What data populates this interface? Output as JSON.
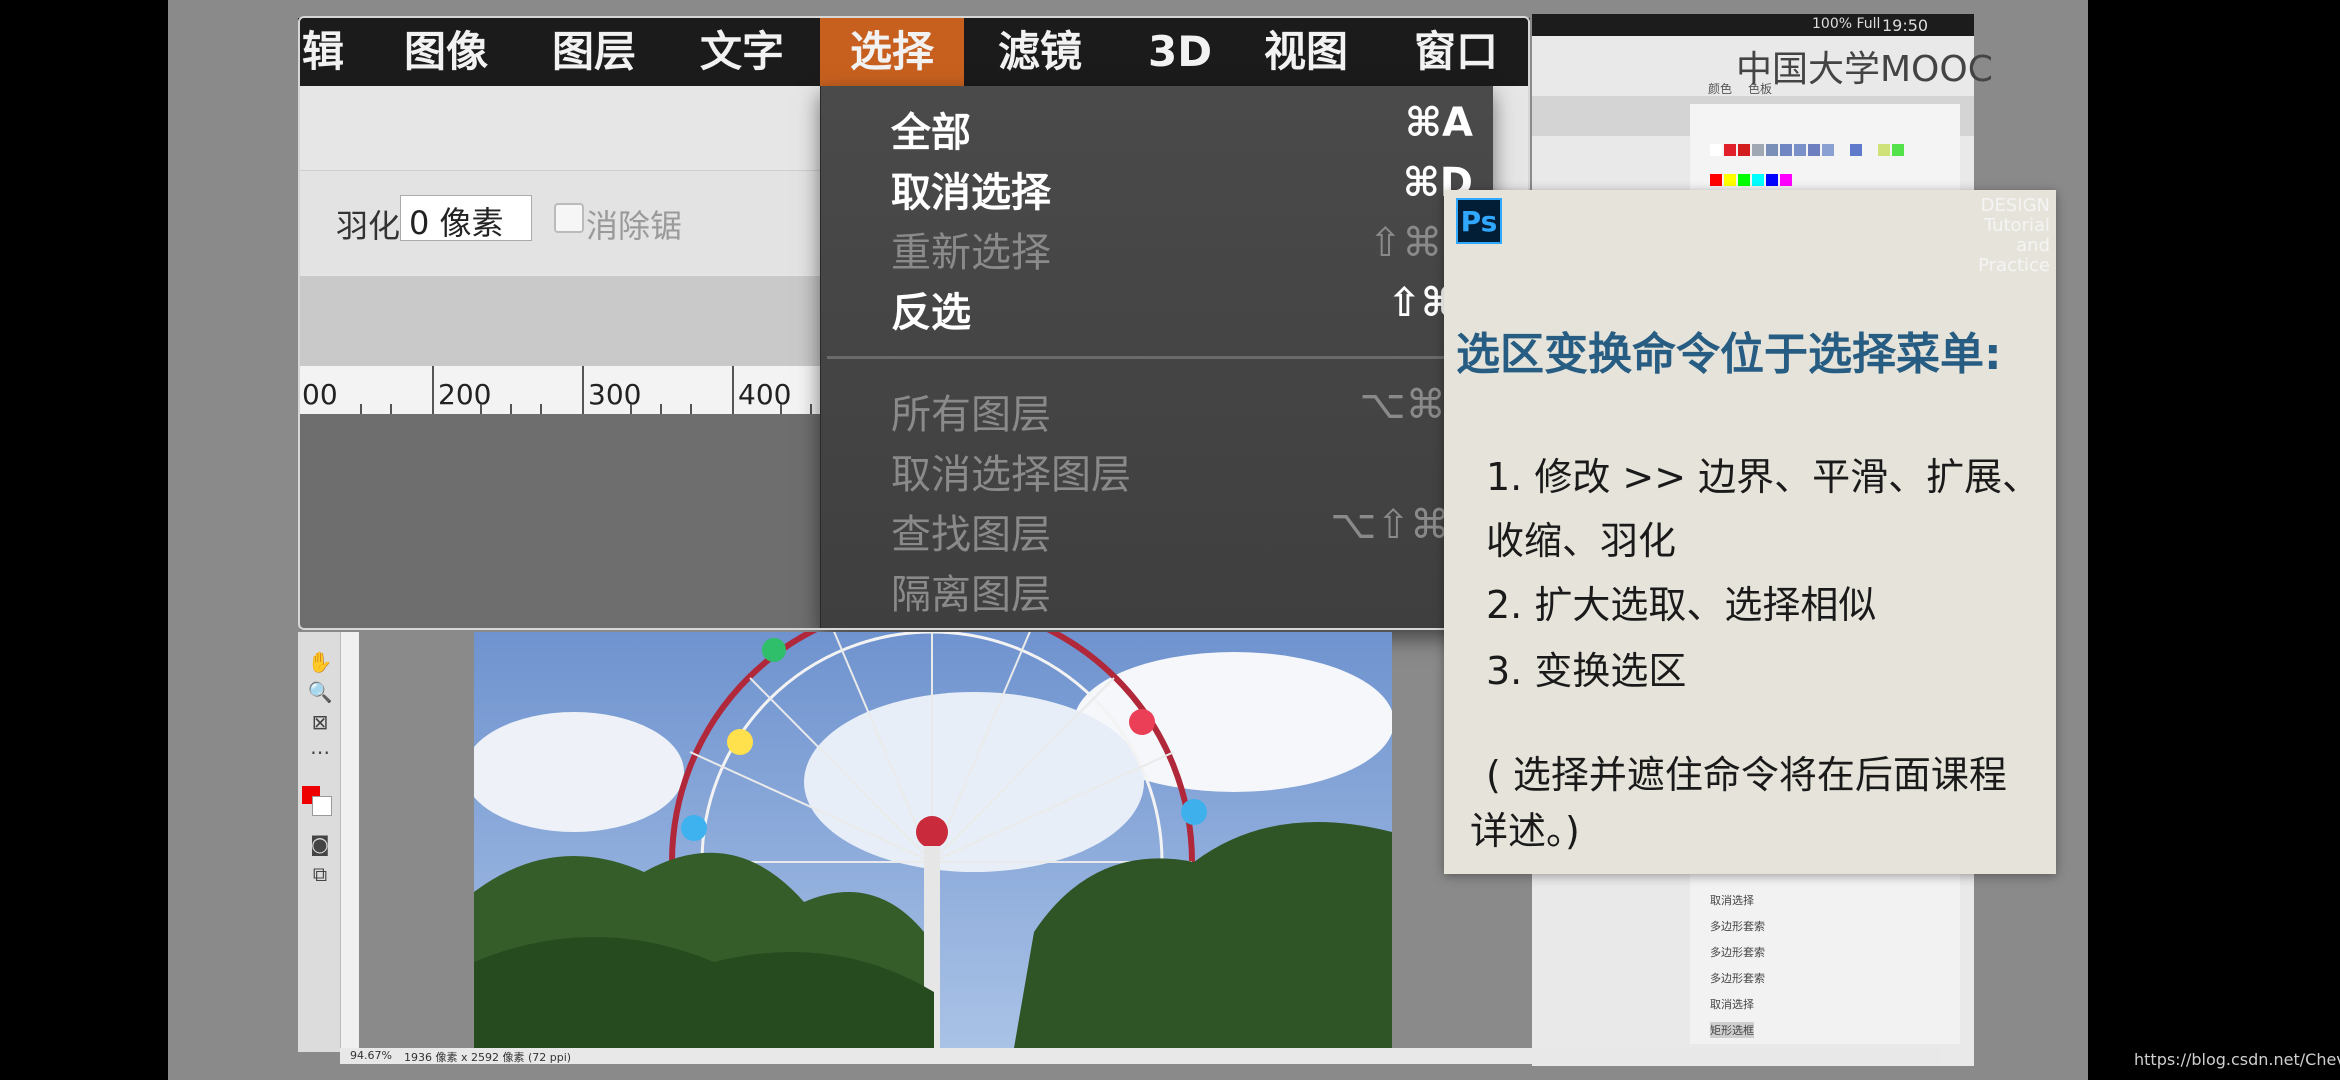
{
  "menubar": {
    "items": [
      "辑",
      "图像",
      "图层",
      "文字",
      "选择",
      "滤镜",
      "3D",
      "视图",
      "窗口"
    ],
    "active": "选择"
  },
  "system_bar": {
    "time": "19:50",
    "battery": "100% Full"
  },
  "options": {
    "feather_label": "羽化:",
    "feather_value": "0 像素",
    "antialias_label": "消除锯"
  },
  "ruler": {
    "labels": [
      "00",
      "200",
      "300",
      "400"
    ]
  },
  "select_menu": {
    "items": [
      {
        "label": "全部",
        "shortcut": "⌘A",
        "enabled": true
      },
      {
        "label": "取消选择",
        "shortcut": "⌘D",
        "enabled": true
      },
      {
        "label": "重新选择",
        "shortcut": "⇧⌘D",
        "enabled": false
      },
      {
        "label": "反选",
        "shortcut": "⇧⌘I",
        "enabled": true
      },
      {
        "label": "所有图层",
        "shortcut": "⌥⌘A",
        "enabled": false
      },
      {
        "label": "取消选择图层",
        "shortcut": "",
        "enabled": false
      },
      {
        "label": "查找图层",
        "shortcut": "⌥⇧⌘F",
        "enabled": false
      },
      {
        "label": "隔离图层",
        "shortcut": "",
        "enabled": false
      }
    ]
  },
  "right_panel": {
    "logo": "中国大学MOOC",
    "tabs": [
      "颜色",
      "色板"
    ],
    "history": [
      "取消选择",
      "多边形套索",
      "多边形套索",
      "多边形套索",
      "取消选择",
      "矩形选框"
    ]
  },
  "card": {
    "badge": "Ps",
    "brand_lines": [
      "DESIGN",
      "Tutorial",
      "and",
      "Practice"
    ],
    "title": "选区变换命令位于选择菜单:",
    "lines": [
      "1. 修改 >> 边界、平滑、扩展、",
      "收缩、羽化",
      "2. 扩大选取、选择相似",
      "3. 变换选区",
      "( 选择并遮住命令将在后面课程",
      "详述。)"
    ]
  },
  "status": {
    "zoom": "94.67%",
    "doc_info": "1936 像素 x 2592 像素 (72 ppi)"
  },
  "watermark": "https://blog.csdn.net/Chevily",
  "colors": {
    "accent_menu": "#c7601f",
    "card_title": "#285d83",
    "menu_bg": "#1b1b1b"
  }
}
